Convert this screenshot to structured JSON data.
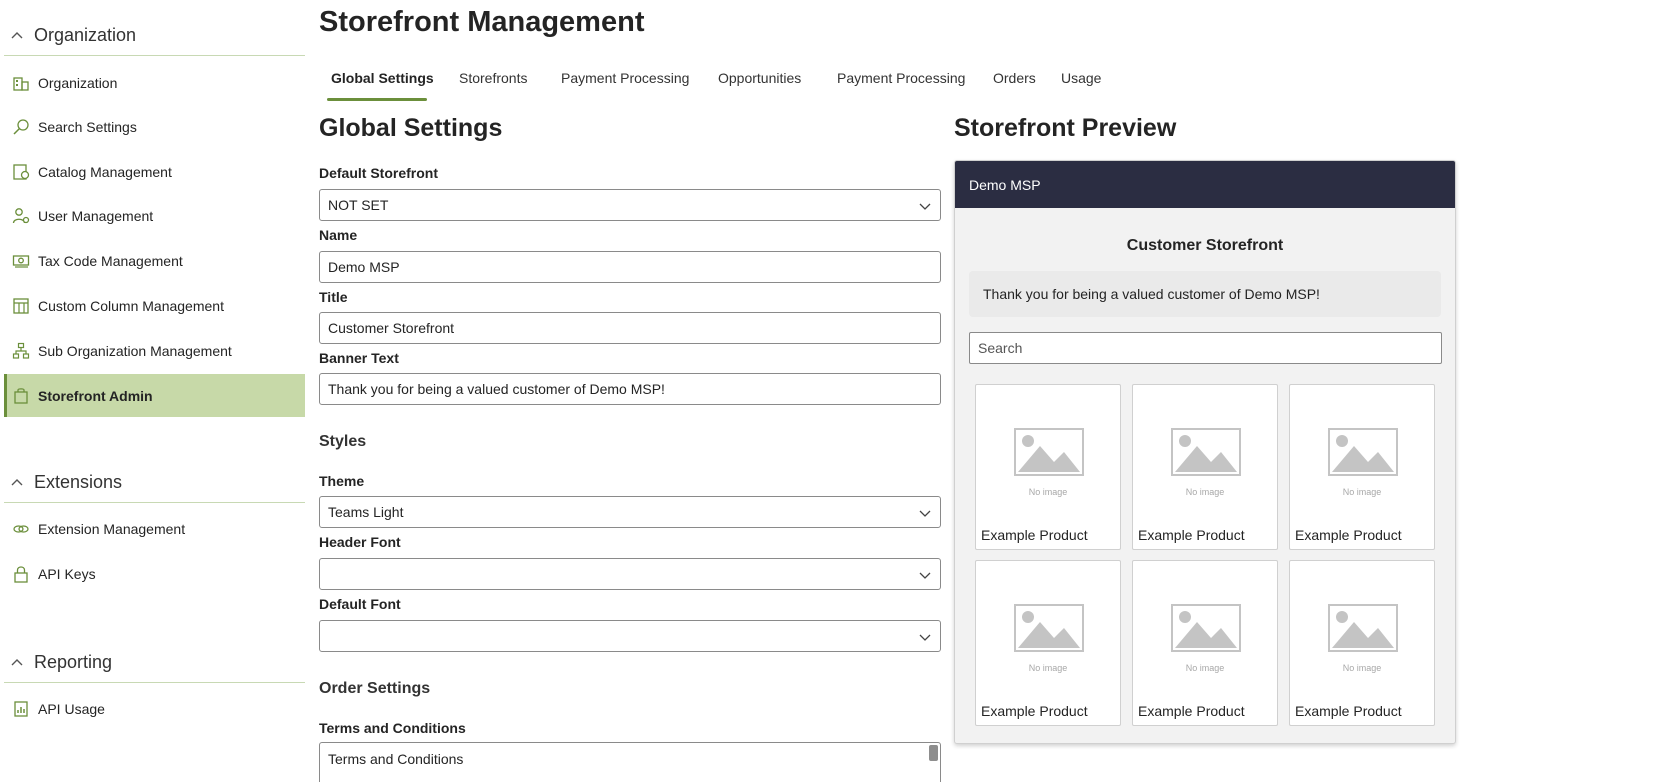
{
  "sidebar": {
    "sections": [
      {
        "title": "Organization",
        "items": [
          {
            "label": "Organization",
            "icon": "building-icon"
          },
          {
            "label": "Search Settings",
            "icon": "search-icon"
          },
          {
            "label": "Catalog Management",
            "icon": "catalog-icon"
          },
          {
            "label": "User Management",
            "icon": "user-gear-icon"
          },
          {
            "label": "Tax Code Management",
            "icon": "money-icon"
          },
          {
            "label": "Custom Column Management",
            "icon": "table-columns-icon"
          },
          {
            "label": "Sub Organization Management",
            "icon": "org-chart-icon"
          },
          {
            "label": "Storefront Admin",
            "icon": "shopping-bag-icon",
            "active": true
          }
        ]
      },
      {
        "title": "Extensions",
        "items": [
          {
            "label": "Extension Management",
            "icon": "link-icon"
          },
          {
            "label": "API Keys",
            "icon": "lock-icon"
          }
        ]
      },
      {
        "title": "Reporting",
        "items": [
          {
            "label": "API Usage",
            "icon": "report-chart-icon"
          }
        ]
      }
    ]
  },
  "page": {
    "title": "Storefront Management"
  },
  "tabs": [
    {
      "label": "Global Settings",
      "active": true
    },
    {
      "label": "Storefronts"
    },
    {
      "label": "Payment Processing"
    },
    {
      "label": "Opportunities"
    },
    {
      "label": "Payment Processing"
    },
    {
      "label": "Orders"
    },
    {
      "label": "Usage"
    }
  ],
  "form": {
    "heading": "Global Settings",
    "default_storefront": {
      "label": "Default Storefront",
      "value": "NOT SET"
    },
    "name": {
      "label": "Name",
      "value": "Demo MSP"
    },
    "title": {
      "label": "Title",
      "value": "Customer Storefront"
    },
    "banner": {
      "label": "Banner Text",
      "value": "Thank you for being a valued customer of Demo MSP!"
    },
    "styles_heading": "Styles",
    "theme": {
      "label": "Theme",
      "value": "Teams Light"
    },
    "header_font": {
      "label": "Header Font",
      "value": ""
    },
    "default_font": {
      "label": "Default Font",
      "value": ""
    },
    "order_heading": "Order Settings",
    "terms": {
      "label": "Terms and Conditions",
      "value": "Terms and Conditions"
    }
  },
  "preview": {
    "heading": "Storefront Preview",
    "header_name": "Demo MSP",
    "title": "Customer Storefront",
    "banner": "Thank you for being a valued customer of Demo MSP!",
    "search_placeholder": "Search",
    "products": [
      {
        "name": "Example Product",
        "image_text": "No image"
      },
      {
        "name": "Example Product",
        "image_text": "No image"
      },
      {
        "name": "Example Product",
        "image_text": "No image"
      },
      {
        "name": "Example Product",
        "image_text": "No image"
      },
      {
        "name": "Example Product",
        "image_text": "No image"
      },
      {
        "name": "Example Product",
        "image_text": "No image"
      }
    ]
  },
  "colors": {
    "accent": "#6b8f3b",
    "active_bg": "#c7d9a8",
    "preview_header": "#2b2d42"
  }
}
